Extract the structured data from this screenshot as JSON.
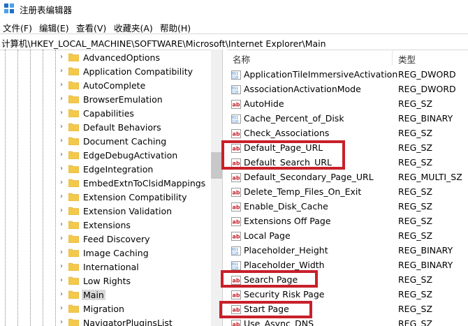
{
  "window": {
    "title": "注册表编辑器",
    "icon": "registry-editor-icon"
  },
  "menu": [
    "文件(F)",
    "编辑(E)",
    "查看(V)",
    "收藏夹(A)",
    "帮助(H)"
  ],
  "address": "计算机\\HKEY_LOCAL_MACHINE\\SOFTWARE\\Microsoft\\Internet Explorer\\Main",
  "tree": {
    "items": [
      {
        "label": "AdvancedOptions"
      },
      {
        "label": "Application Compatibility"
      },
      {
        "label": "AutoComplete"
      },
      {
        "label": "BrowserEmulation"
      },
      {
        "label": "Capabilities"
      },
      {
        "label": "Default Behaviors"
      },
      {
        "label": "Document Caching"
      },
      {
        "label": "EdgeDebugActivation"
      },
      {
        "label": "EdgeIntegration"
      },
      {
        "label": "EmbedExtnToClsidMappings"
      },
      {
        "label": "Extension Compatibility"
      },
      {
        "label": "Extension Validation"
      },
      {
        "label": "Extensions"
      },
      {
        "label": "Feed Discovery"
      },
      {
        "label": "Image Caching"
      },
      {
        "label": "International"
      },
      {
        "label": "Low Rights"
      },
      {
        "label": "Main",
        "selected": true
      },
      {
        "label": "Migration"
      },
      {
        "label": "NavigatorPluginsList"
      }
    ]
  },
  "list": {
    "headers": {
      "name": "名称",
      "type": "类型"
    },
    "rows": [
      {
        "name": "ApplicationTileImmersiveActivation",
        "type": "REG_DWORD",
        "icon": "binary"
      },
      {
        "name": "AssociationActivationMode",
        "type": "REG_DWORD",
        "icon": "binary"
      },
      {
        "name": "AutoHide",
        "type": "REG_SZ",
        "icon": "string"
      },
      {
        "name": "Cache_Percent_of_Disk",
        "type": "REG_BINARY",
        "icon": "binary"
      },
      {
        "name": "Check_Associations",
        "type": "REG_SZ",
        "icon": "string"
      },
      {
        "name": "Default_Page_URL",
        "type": "REG_SZ",
        "icon": "string"
      },
      {
        "name": "Default_Search_URL",
        "type": "REG_SZ",
        "icon": "string"
      },
      {
        "name": "Default_Secondary_Page_URL",
        "type": "REG_MULTI_SZ",
        "icon": "string"
      },
      {
        "name": "Delete_Temp_Files_On_Exit",
        "type": "REG_SZ",
        "icon": "string"
      },
      {
        "name": "Enable_Disk_Cache",
        "type": "REG_SZ",
        "icon": "string"
      },
      {
        "name": "Extensions Off Page",
        "type": "REG_SZ",
        "icon": "string"
      },
      {
        "name": "Local Page",
        "type": "REG_SZ",
        "icon": "string"
      },
      {
        "name": "Placeholder_Height",
        "type": "REG_BINARY",
        "icon": "binary"
      },
      {
        "name": "Placeholder_Width",
        "type": "REG_BINARY",
        "icon": "binary"
      },
      {
        "name": "Search Page",
        "type": "REG_SZ",
        "icon": "string"
      },
      {
        "name": "Security Risk Page",
        "type": "REG_SZ",
        "icon": "string"
      },
      {
        "name": "Start Page",
        "type": "REG_SZ",
        "icon": "string"
      },
      {
        "name": "Use_Async_DNS",
        "type": "REG_SZ",
        "icon": "string"
      }
    ]
  },
  "colors": {
    "highlight_box": "#c8202a",
    "folder": "#f3c94c",
    "selection": "#d9d9d9"
  }
}
